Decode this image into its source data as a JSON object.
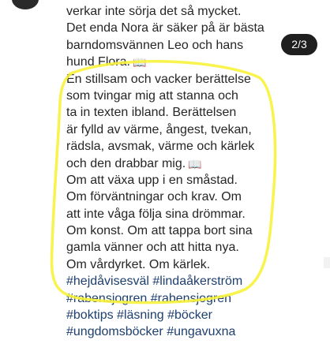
{
  "post": {
    "caption_lines": [
      "verkar inte sörja det så mycket.",
      "Det enda Nora är säker på är bästa",
      "barndomsvännen Leo och hans",
      "hund Flora.",
      "En stillsam och vacker berättelse",
      "som tvingar mig att stanna och",
      "ta in texten ibland. Berättelsen",
      "är fylld av värme, ångest, tvekan,",
      "rädsla, avsmak, värme och kärlek",
      "och den drabbar mig.",
      "Om att växa upp i en småstad.",
      "Om förväntningar och krav. Om",
      "att inte våga följa sina drömmar.",
      "Om konst. Om att tappa bort sina",
      "gamla vänner och att hitta nya.",
      "Om vårdyrket. Om kärlek."
    ],
    "book_emoji": "📖",
    "hashtag_lines": [
      "#hejdåvisesväl #lindaåkerström",
      "#rabensjogren #rabensjogren",
      "#boktips #läsning #böcker",
      "#ungdomsböcker #ungavuxna"
    ]
  },
  "counter": {
    "label": "2/3"
  },
  "highlight": {
    "color": "#f7f23a"
  },
  "colors": {
    "text": "#262626",
    "hashtag": "#1d3f6e"
  }
}
